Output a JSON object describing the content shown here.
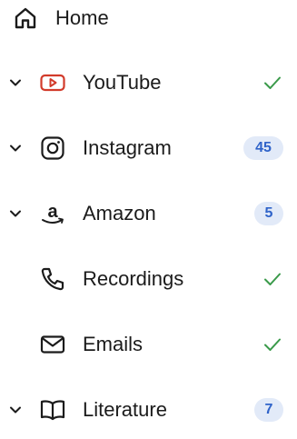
{
  "home": {
    "label": "Home",
    "icon": "home-icon"
  },
  "items": [
    {
      "label": "YouTube",
      "icon": "youtube-icon",
      "expandable": true,
      "status": "check"
    },
    {
      "label": "Instagram",
      "icon": "instagram-icon",
      "expandable": true,
      "badge": "45"
    },
    {
      "label": "Amazon",
      "icon": "amazon-icon",
      "expandable": true,
      "badge": "5"
    },
    {
      "label": "Recordings",
      "icon": "phone-icon",
      "expandable": false,
      "status": "check"
    },
    {
      "label": "Emails",
      "icon": "mail-icon",
      "expandable": false,
      "status": "check"
    },
    {
      "label": "Literature",
      "icon": "book-icon",
      "expandable": true,
      "badge": "7"
    }
  ],
  "colors": {
    "text": "#1b1b1b",
    "check": "#3a9a4a",
    "badge_bg": "#e2eaf8",
    "badge_text": "#2f63c9",
    "youtube": "#d23b2b"
  }
}
